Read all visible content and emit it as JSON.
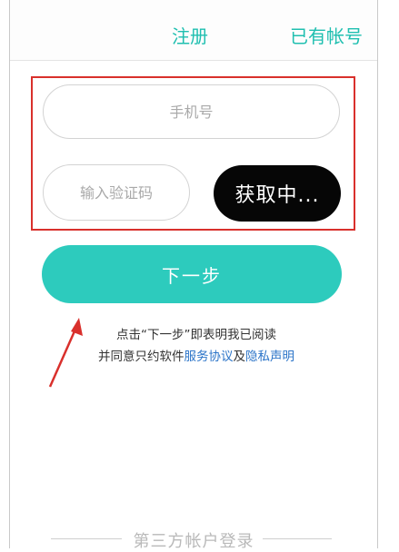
{
  "header": {
    "title": "注册",
    "login_link": "已有帐号"
  },
  "form": {
    "phone_placeholder": "手机号",
    "code_placeholder": "输入验证码",
    "get_code_label": "获取中...",
    "next_label": "下一步"
  },
  "notice": {
    "line1": "点击“下一步”即表明我已阅读",
    "line2_prefix": "并同意只约软件",
    "service_agreement": "服务协议",
    "connector": "及",
    "privacy_policy": "隐私声明"
  },
  "footer": {
    "third_party_label": "第三方帐户登录"
  },
  "colors": {
    "accent": "#2dcbbd",
    "header_text": "#1fbfb0",
    "link": "#2b74c8",
    "highlight": "#d9302c",
    "get_code_bg": "#060606"
  },
  "annotations": {
    "highlight_box": "red-rectangle",
    "arrow": "red-arrow-icon"
  }
}
